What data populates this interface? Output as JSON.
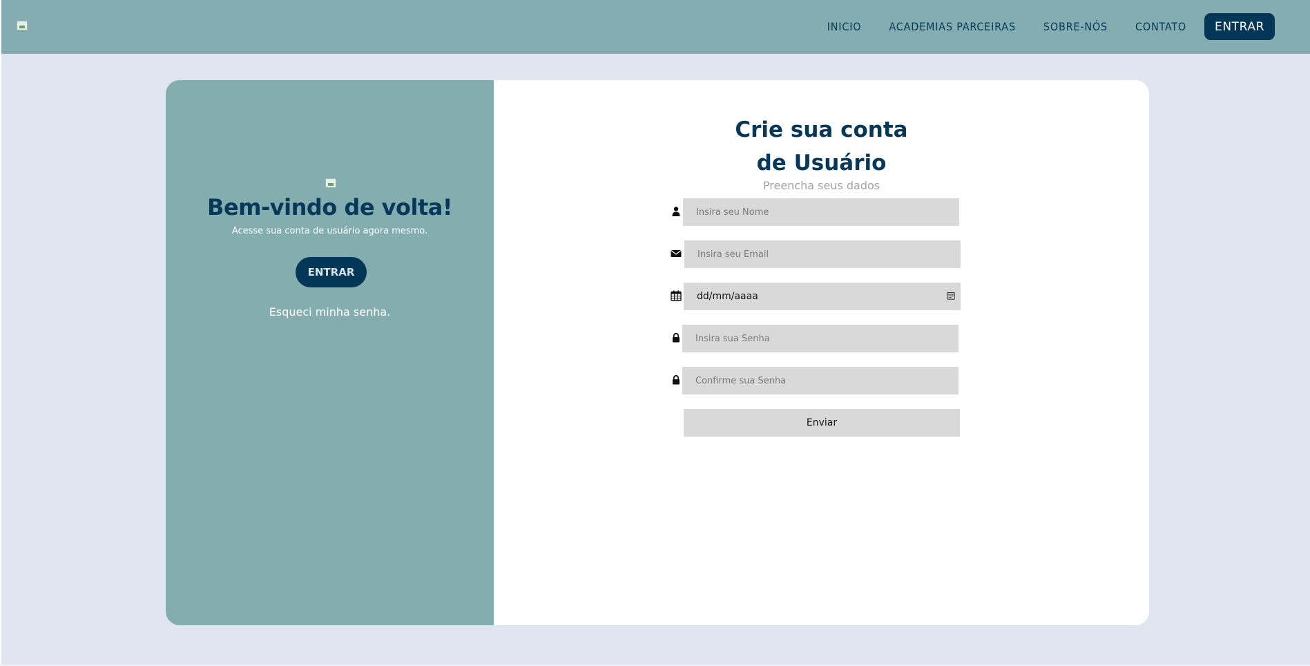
{
  "header": {
    "nav": [
      "INICIO",
      "ACADEMIAS PARCEIRAS",
      "SOBRE-NÓS",
      "CONTATO"
    ],
    "entrar_label": "ENTRAR"
  },
  "welcome": {
    "title": "Bem-vindo de volta!",
    "subtitle": "Acesse sua conta de usuário agora mesmo.",
    "entrar_label": "ENTRAR",
    "forgot_label": "Esqueci minha senha."
  },
  "form": {
    "title_line1": "Crie sua conta",
    "title_line2": "de Usuário",
    "subtitle": "Preencha seus dados",
    "name_placeholder": "Insira seu Nome",
    "email_placeholder": "Insira seu Email",
    "date_value": "dd/mm/aaaa",
    "password_placeholder": "Insira sua Senha",
    "confirm_placeholder": "Confirme sua Senha",
    "submit_label": "Enviar"
  },
  "colors": {
    "primary": "#043657",
    "accent_panel": "#84adb0",
    "background": "#e1e5f0"
  }
}
